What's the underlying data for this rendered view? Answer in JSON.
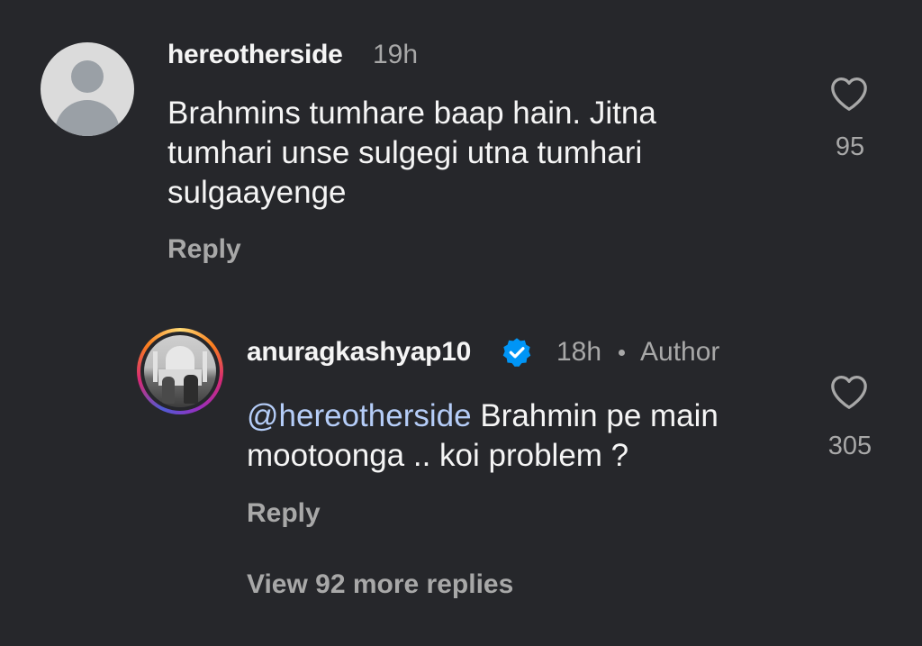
{
  "comments": [
    {
      "username": "hereotherside",
      "time": "19h",
      "text_lines": [
        "Brahmins tumhare baap hain. Jitna",
        "tumhari unse sulgegi utna tumhari",
        "sulgaayenge"
      ],
      "reply_label": "Reply",
      "likes": "95",
      "avatar": "default-avatar-icon"
    }
  ],
  "replies": [
    {
      "username": "anuragkashyap10",
      "verified": true,
      "time": "18h",
      "author_badge": "Author",
      "mention": "@hereotherside",
      "text_line1": "Brahmin pe main",
      "text_line2": "mootoonga .. koi problem ?",
      "reply_label": "Reply",
      "likes": "305"
    }
  ],
  "view_more": "View 92 more replies",
  "colors": {
    "background": "#26272b",
    "text": "#f5f5f5",
    "muted": "#a8a8a8",
    "mention": "#b5cdf8",
    "verified": "#0095f6"
  }
}
